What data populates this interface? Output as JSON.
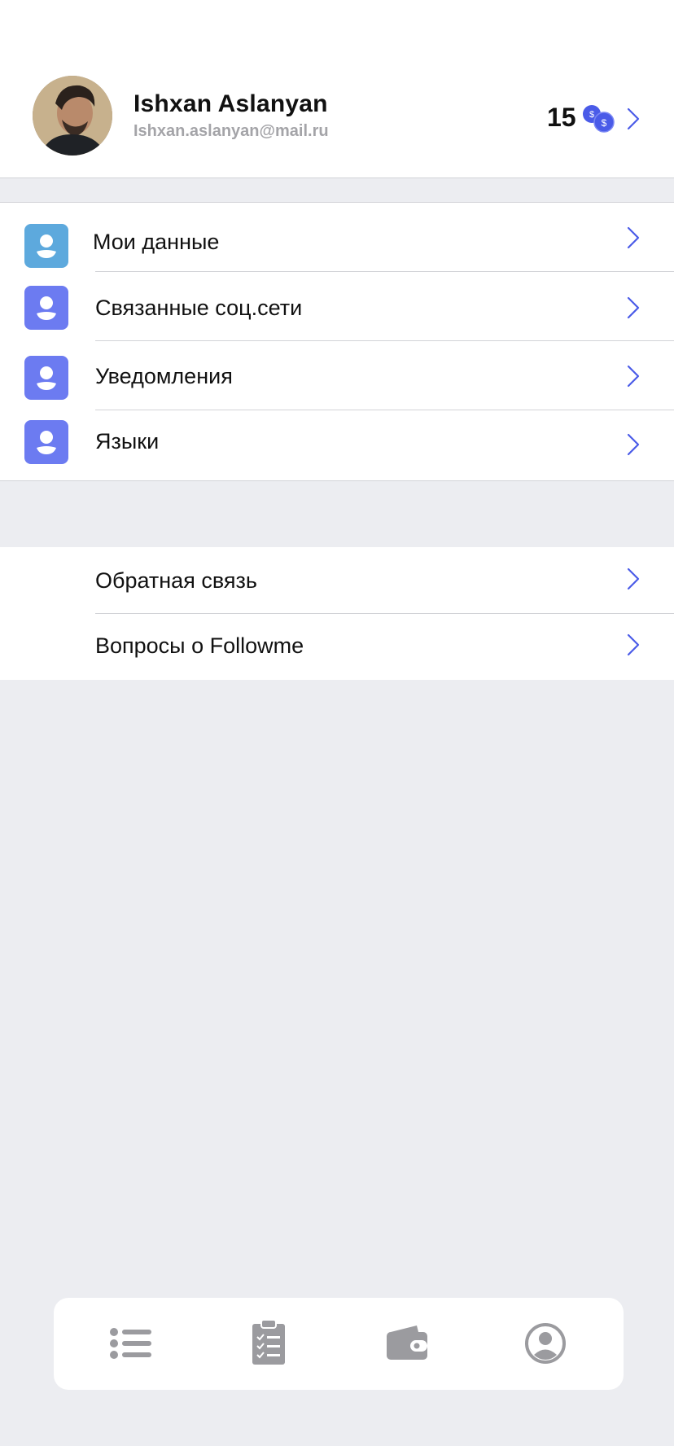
{
  "profile": {
    "name": "Ishxan Aslanyan",
    "email": "Ishxan.aslanyan@mail.ru",
    "balance": "15",
    "coin_icon": "coins-icon"
  },
  "settings_menu": [
    {
      "label": "Мои данные",
      "icon": "user-icon",
      "icon_color": "#5DA9DD"
    },
    {
      "label": "Связанные соц.сети",
      "icon": "user-icon",
      "icon_color": "#6C7BF1"
    },
    {
      "label": "Уведомления",
      "icon": "user-icon",
      "icon_color": "#6C7BF1"
    },
    {
      "label": "Языки",
      "icon": "user-icon",
      "icon_color": "#6C7BF1"
    }
  ],
  "support_menu": [
    {
      "label": "Обратная связь"
    },
    {
      "label": "Вопросы о Followme"
    }
  ],
  "tabbar": [
    {
      "icon": "list-icon",
      "active": false
    },
    {
      "icon": "clipboard-checklist-icon",
      "active": false
    },
    {
      "icon": "wallet-icon",
      "active": false
    },
    {
      "icon": "profile-icon",
      "active": true
    }
  ],
  "colors": {
    "accent": "#4A5BE8",
    "tile_blue": "#6C7BF1",
    "tile_light_blue": "#5DA9DD",
    "background": "#ECEDF1",
    "tab_icon": "#9B9B9F"
  }
}
